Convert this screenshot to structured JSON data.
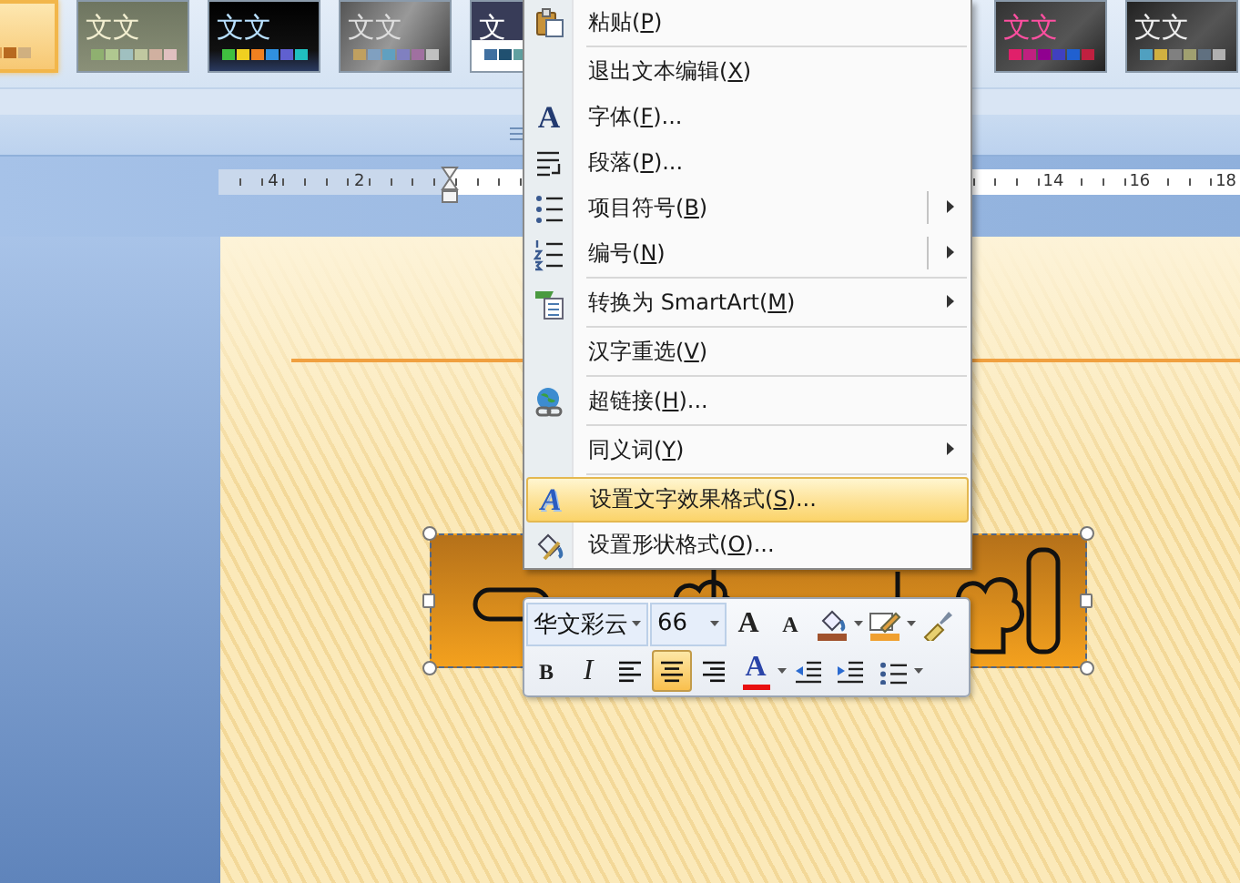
{
  "theme_gallery": {
    "left": [
      {
        "selected": true
      },
      {
        "label": "文文",
        "selected": false
      },
      {
        "label": "文文",
        "selected": false
      },
      {
        "label": "文文",
        "selected": false
      },
      {
        "label": "文",
        "selected": false
      }
    ],
    "right": [
      {
        "label": "文文",
        "selected": false
      },
      {
        "label": "文文",
        "selected": false
      }
    ]
  },
  "ruler": {
    "left_labels": [
      "4",
      "2"
    ],
    "right_labels": [
      "14",
      "16",
      "18"
    ]
  },
  "context_menu": {
    "items": [
      {
        "kind": "plain",
        "label": "粘贴(P)",
        "selected": false
      },
      {
        "kind": "separator"
      },
      {
        "kind": "plain",
        "label": "退出文本编辑(X)",
        "selected": false
      },
      {
        "kind": "plain",
        "icon_text": "A",
        "label": "字体(F)...",
        "selected": false
      },
      {
        "kind": "plain",
        "label": "段落(P)...",
        "selected": false
      },
      {
        "kind": "split",
        "label": "项目符号(B)",
        "selected": false
      },
      {
        "kind": "split",
        "label": "编号(N)",
        "selected": false
      },
      {
        "kind": "separator"
      },
      {
        "kind": "submenu",
        "label": "转换为 SmartArt(M)",
        "selected": false
      },
      {
        "kind": "separator"
      },
      {
        "kind": "plain",
        "label": "汉字重选(V)",
        "selected": false
      },
      {
        "kind": "separator"
      },
      {
        "kind": "plain",
        "label": "超链接(H)...",
        "selected": false
      },
      {
        "kind": "separator"
      },
      {
        "kind": "submenu",
        "label": "同义词(Y)",
        "selected": false
      },
      {
        "kind": "separator"
      },
      {
        "kind": "plain",
        "icon_text": "A",
        "label": "设置文字效果格式(S)...",
        "selected": true
      },
      {
        "kind": "plain",
        "label": "设置形状格式(O)...",
        "selected": false
      }
    ]
  },
  "mini_toolbar": {
    "font_field": {
      "value": "华文彩云"
    },
    "size_field": {
      "value": "66"
    },
    "grow_font": {
      "label": "A"
    },
    "shrink_font": {
      "label": "A"
    },
    "fill_color": {
      "color": "#a0522d"
    },
    "line_color": {
      "color": "#f0a030"
    },
    "bold": {
      "label": "B"
    },
    "italic": {
      "label": "I"
    },
    "alignment": [
      {
        "selected": false
      },
      {
        "selected": true
      },
      {
        "selected": false
      }
    ],
    "font_color": {
      "label": "A",
      "color": "#e81010"
    }
  }
}
